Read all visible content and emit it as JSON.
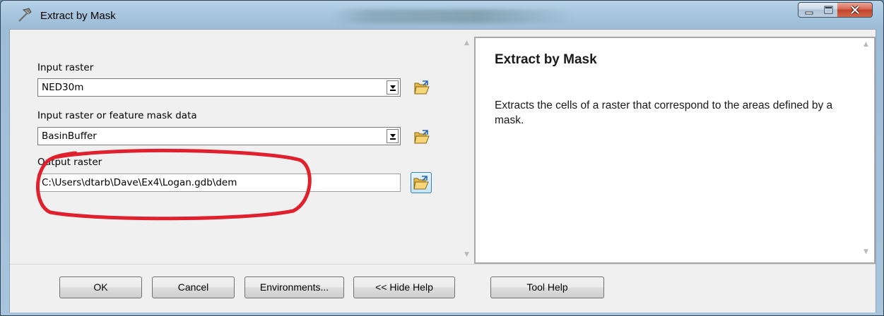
{
  "window": {
    "title": "Extract by Mask",
    "icon": "hammer-icon",
    "controls": [
      "minimize-icon",
      "maximize-icon",
      "close-icon"
    ]
  },
  "form": {
    "input_raster": {
      "label": "Input raster",
      "value": "NED30m"
    },
    "mask_data": {
      "label": "Input raster or feature mask data",
      "value": "BasinBuffer"
    },
    "output_raster": {
      "label": "Output raster",
      "value": "C:\\Users\\dtarb\\Dave\\Ex4\\Logan.gdb\\dem"
    },
    "browse_icon": "folder-open-icon",
    "annotation": {
      "shape": "freehand ellipse",
      "color": "#e0202c"
    }
  },
  "help": {
    "title": "Extract by Mask",
    "description": "Extracts the cells of a raster that correspond to the areas defined by a mask."
  },
  "buttons": {
    "ok": "OK",
    "cancel": "Cancel",
    "environments": "Environments...",
    "hide_help": "<< Hide Help",
    "tool_help": "Tool Help"
  },
  "colors": {
    "titlebar": "#a7c6df",
    "close_button": "#c2432c",
    "annotation": "#e0202c",
    "browse_active": "#c4e5f6"
  }
}
